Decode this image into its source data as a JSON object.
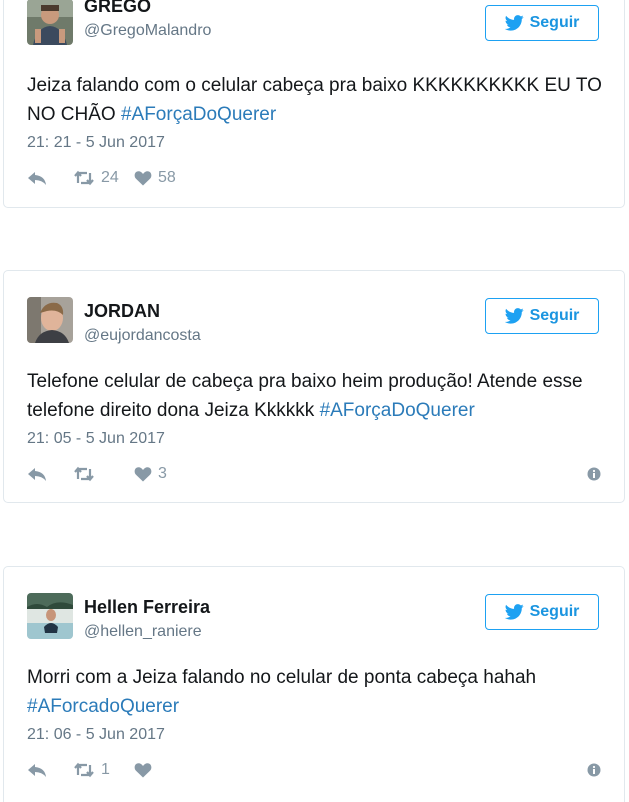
{
  "follow_label": "Seguir",
  "colors": {
    "link": "#2b7bb9",
    "follow": "#1da1f2",
    "muted": "#657786",
    "icon": "#8899a6"
  },
  "tweets": [
    {
      "name": "GREGO",
      "handle": "@GregoMalandro",
      "text": "Jeiza falando com o celular cabeça pra baixo KKKKKKKKKK EU TO NO CHÃO ",
      "hashtag": "#AForçaDoQuerer",
      "date": "21: 21 - 5 Jun 2017",
      "retweets": "24",
      "likes": "58"
    },
    {
      "name": "JORDAN",
      "handle": "@eujordancosta",
      "text": "Telefone celular de cabeça pra baixo heim produção! Atende esse telefone direito dona Jeiza Kkkkkk ",
      "hashtag": "#AForçaDoQuerer",
      "date": "21: 05 - 5 Jun 2017",
      "retweets": "",
      "likes": "3"
    },
    {
      "name": "Hellen Ferreira",
      "handle": "@hellen_raniere",
      "text": "Morri com a Jeiza falando no celular de ponta cabeça hahah ",
      "hashtag": "#AForcadoQuerer",
      "date": "21: 06 - 5 Jun 2017",
      "retweets": "1",
      "likes": ""
    }
  ]
}
